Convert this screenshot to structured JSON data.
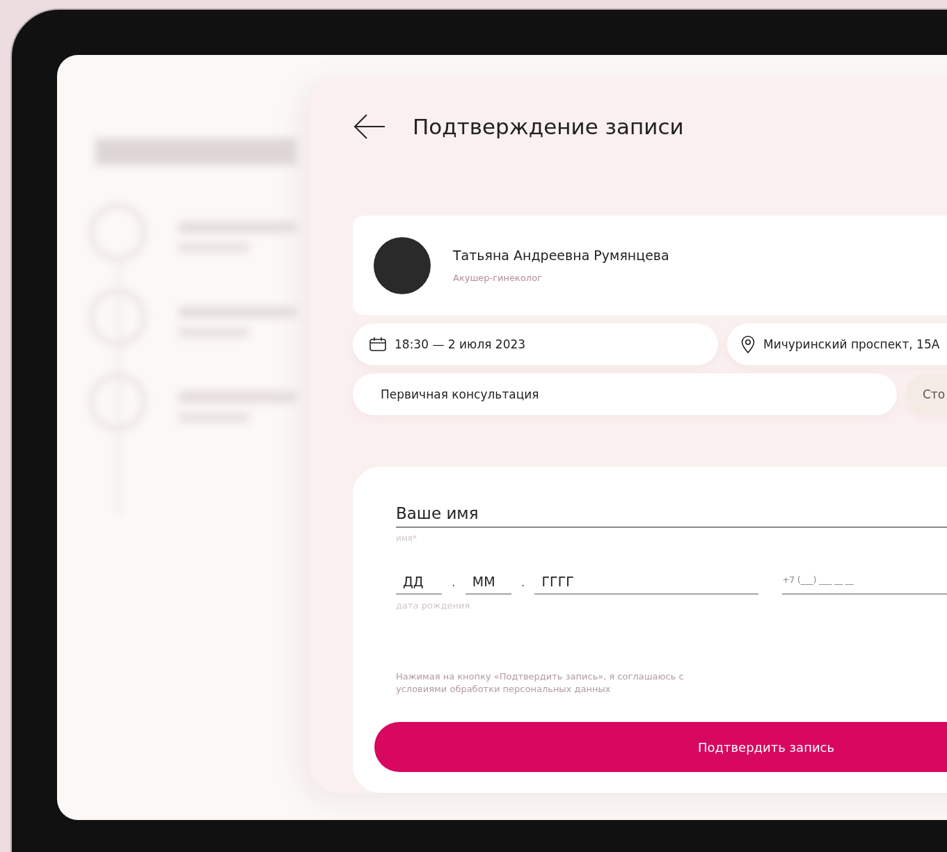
{
  "header": {
    "title": "Подтверждение записи"
  },
  "doctor": {
    "name": "Татьяна Андреевна Румянцева",
    "specialty": "Акушер-гинеколог"
  },
  "details": [
    {
      "kind": "date",
      "text": "18:30 — 2 июля 2023"
    },
    {
      "kind": "address",
      "text": "Мичуринский проспект, 15А"
    }
  ],
  "service": {
    "name": "Первичная консультация",
    "price_label": "Сто"
  },
  "form": {
    "name_field": {
      "placeholder": "Ваше имя",
      "hint": "имя*"
    },
    "birth_date": {
      "day_placeholder": "ДД",
      "month_placeholder": "ММ",
      "year_placeholder": "ГГГГ",
      "separators": [
        ".",
        "."
      ],
      "hint": "дата рождения"
    },
    "phone": {
      "placeholder": "+7 (___) ___ __ __"
    },
    "consent": "Нажимая на кнопку «Подтвердить запись», я соглашаюсь с условиями обработки персональных данных",
    "submit": "Подтвердить запись"
  }
}
